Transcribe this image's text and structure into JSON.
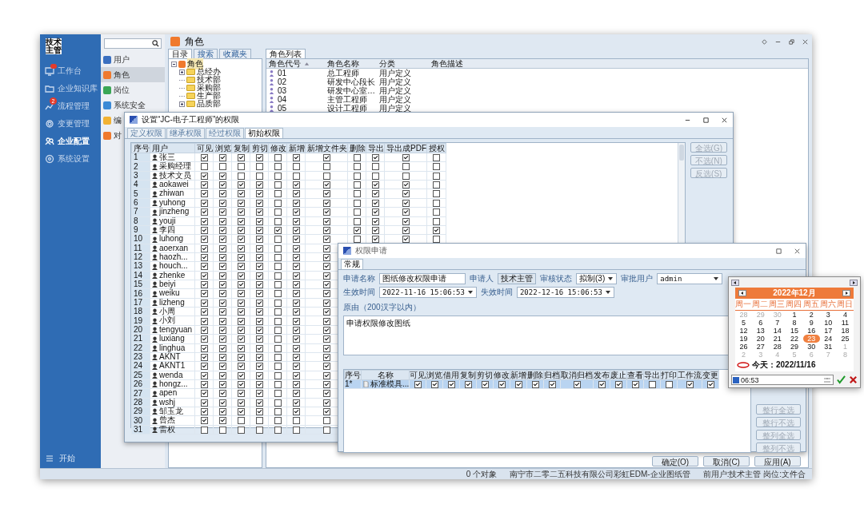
{
  "app": {
    "logo": "技术主管",
    "nav": [
      {
        "label": "工作台",
        "selected": false,
        "alert": true
      },
      {
        "label": "企业知识库",
        "selected": false,
        "alert": false
      },
      {
        "label": "流程管理",
        "selected": false,
        "alert": false,
        "badge": "2"
      },
      {
        "label": "变更管理",
        "selected": false,
        "alert": false
      },
      {
        "label": "企业配置",
        "selected": true,
        "alert": false
      },
      {
        "label": "系统设置",
        "selected": false,
        "alert": false
      }
    ],
    "start": "开始"
  },
  "modules": {
    "items": [
      {
        "label": "用户",
        "selected": false,
        "color": "#3a6fc0"
      },
      {
        "label": "角色",
        "selected": true,
        "color": "#f07a2e"
      },
      {
        "label": "岗位",
        "selected": false,
        "color": "#3aa655"
      },
      {
        "label": "系统安全",
        "selected": false,
        "color": "#3b8ad6"
      },
      {
        "label": "编",
        "selected": false,
        "color": "#f2b233"
      },
      {
        "label": "对",
        "selected": false,
        "color": "#f07a2e"
      }
    ]
  },
  "role_page": {
    "title": "角色",
    "tabs": [
      {
        "label": "目录",
        "selected": true
      },
      {
        "label": "搜索",
        "selected": false
      },
      {
        "label": "收藏夹",
        "selected": false
      }
    ],
    "tree": {
      "label": "角色",
      "selected": true,
      "children": [
        {
          "label": "总经办",
          "expandable": true,
          "selected": false
        },
        {
          "label": "技术部",
          "expandable": false,
          "selected": false
        },
        {
          "label": "采购部",
          "expandable": false,
          "selected": false
        },
        {
          "label": "生产部",
          "expandable": false,
          "selected": false
        },
        {
          "label": "品质部",
          "expandable": true,
          "selected": false
        }
      ]
    },
    "list_tab": "角色列表",
    "columns": [
      {
        "label": "角色代号",
        "sorted": true
      },
      {
        "label": "角色名称",
        "sorted": false
      },
      {
        "label": "分类",
        "sorted": false
      },
      {
        "label": "角色描述",
        "sorted": false
      }
    ],
    "rows": [
      [
        "01",
        "总工程师",
        "用户定义"
      ],
      [
        "02",
        "研发中心段长",
        "用户定义"
      ],
      [
        "03",
        "研发中心室…",
        "用户定义"
      ],
      [
        "04",
        "主管工程师",
        "用户定义"
      ],
      [
        "05",
        "设计工程师",
        "用户定义"
      ]
    ]
  },
  "perm_dialog": {
    "title": "设置“JC-电子工程师”的权限",
    "tabs": [
      {
        "label": "定义权限",
        "selected": false
      },
      {
        "label": "继承权限",
        "selected": false
      },
      {
        "label": "经过权限",
        "selected": false
      },
      {
        "label": "初始权限",
        "selected": true
      }
    ],
    "columns": [
      "序号",
      "用户",
      "可见",
      "浏览",
      "复制",
      "剪切",
      "修改",
      "新增",
      "新增文件夹",
      "删除",
      "导出",
      "导出成PDF",
      "授权"
    ],
    "rows": [
      {
        "no": "1",
        "user": "张三",
        "checks": [
          true,
          true,
          true,
          true,
          false,
          true,
          true,
          false,
          true,
          true,
          false
        ]
      },
      {
        "no": "2",
        "user": "采购经理",
        "checks": [
          false,
          false,
          false,
          false,
          false,
          false,
          false,
          false,
          false,
          false,
          false
        ]
      },
      {
        "no": "3",
        "user": "技术文员",
        "checks": [
          true,
          true,
          false,
          false,
          false,
          false,
          false,
          false,
          false,
          false,
          false
        ]
      },
      {
        "no": "4",
        "user": "aokawei",
        "checks": [
          true,
          true,
          true,
          true,
          false,
          true,
          true,
          false,
          true,
          true,
          false
        ]
      },
      {
        "no": "5",
        "user": "zhiwan",
        "checks": [
          true,
          true,
          true,
          true,
          false,
          true,
          true,
          false,
          true,
          true,
          false
        ]
      },
      {
        "no": "6",
        "user": "yuhong",
        "checks": [
          true,
          true,
          true,
          true,
          false,
          true,
          true,
          false,
          true,
          true,
          false
        ]
      },
      {
        "no": "7",
        "user": "jinzheng",
        "checks": [
          true,
          true,
          true,
          true,
          false,
          true,
          true,
          false,
          true,
          true,
          false
        ]
      },
      {
        "no": "8",
        "user": "youji",
        "checks": [
          true,
          true,
          true,
          true,
          false,
          true,
          true,
          false,
          true,
          true,
          false
        ]
      },
      {
        "no": "9",
        "user": "李四",
        "checks": [
          true,
          true,
          true,
          true,
          true,
          true,
          true,
          true,
          true,
          true,
          true
        ]
      },
      {
        "no": "10",
        "user": "luhong",
        "checks": [
          true,
          true,
          true,
          true,
          false,
          true,
          true,
          false,
          true,
          true,
          false
        ]
      },
      {
        "no": "11",
        "user": "aoerxan",
        "checks": [
          true,
          true,
          true,
          true,
          false,
          true,
          true
        ]
      },
      {
        "no": "12",
        "user": "haozh...",
        "checks": [
          true,
          true,
          true,
          true,
          false,
          true,
          true
        ]
      },
      {
        "no": "13",
        "user": "houch...",
        "checks": [
          true,
          true,
          true,
          true,
          false,
          true,
          true
        ]
      },
      {
        "no": "14",
        "user": "zhenke",
        "checks": [
          true,
          true,
          true,
          true,
          false,
          true,
          true
        ]
      },
      {
        "no": "15",
        "user": "beiyi",
        "checks": [
          true,
          true,
          true,
          true,
          false,
          true,
          true
        ]
      },
      {
        "no": "16",
        "user": "weiku",
        "checks": [
          true,
          true,
          true,
          true,
          false,
          true,
          true
        ]
      },
      {
        "no": "17",
        "user": "lizheng",
        "checks": [
          true,
          true,
          true,
          true,
          false,
          true,
          true
        ]
      },
      {
        "no": "18",
        "user": "小周",
        "checks": [
          true,
          true,
          true,
          true,
          false,
          true,
          true
        ]
      },
      {
        "no": "19",
        "user": "小刘",
        "checks": [
          true,
          true,
          true,
          true,
          false,
          true,
          true
        ]
      },
      {
        "no": "20",
        "user": "tengyuan",
        "checks": [
          true,
          true,
          true,
          true,
          false,
          true,
          true
        ]
      },
      {
        "no": "21",
        "user": "luxiang",
        "checks": [
          true,
          true,
          true,
          true,
          false,
          true,
          true
        ]
      },
      {
        "no": "22",
        "user": "linghua",
        "checks": [
          true,
          true,
          true,
          true,
          false,
          true,
          true
        ]
      },
      {
        "no": "23",
        "user": "AKNT",
        "checks": [
          true,
          true,
          true,
          true,
          false,
          true,
          true
        ]
      },
      {
        "no": "24",
        "user": "AKNT1",
        "checks": [
          true,
          true,
          true,
          true,
          false,
          true,
          true
        ]
      },
      {
        "no": "25",
        "user": "wenda",
        "checks": [
          true,
          true,
          true,
          true,
          false,
          true,
          true
        ]
      },
      {
        "no": "26",
        "user": "hongz...",
        "checks": [
          true,
          true,
          true,
          true,
          false,
          true,
          true
        ]
      },
      {
        "no": "27",
        "user": "apen",
        "checks": [
          true,
          true,
          true,
          true,
          false,
          true,
          true
        ]
      },
      {
        "no": "28",
        "user": "wshj",
        "checks": [
          true,
          true,
          true,
          true,
          false,
          true,
          true
        ]
      },
      {
        "no": "29",
        "user": "邹玉龙",
        "checks": [
          true,
          true,
          true,
          true,
          false,
          true,
          true
        ]
      },
      {
        "no": "30",
        "user": "曾杰",
        "checks": [
          true,
          true,
          false,
          false,
          false,
          false,
          false
        ]
      },
      {
        "no": "31",
        "user": "雷权",
        "checks": [
          false,
          false,
          false,
          false,
          false,
          false,
          false
        ]
      }
    ],
    "buttons": [
      {
        "label": "全选(G)",
        "disabled": true
      },
      {
        "label": "不选(N)",
        "disabled": true
      },
      {
        "label": "反选(S)",
        "disabled": true
      }
    ]
  },
  "request_dialog": {
    "title": "权限申请",
    "tab": "常规",
    "name_label": "申请名称",
    "name": "图纸修改权限申请",
    "applicant_label": "申请人",
    "applicant": "技术主管",
    "status_label": "审核状态",
    "status": "拟制(3)",
    "approver_label": "审批用户",
    "approver": "admin",
    "start_label": "生效时间",
    "start": "2022-11-16 15:06:53",
    "end_label": "失效时间",
    "end": "2022-12-16 15:06:53",
    "reason_label": "原由（200汉字以内）",
    "reason": "申请权限修改图纸",
    "columns": [
      "序号",
      "名称",
      "可见",
      "浏览",
      "借用",
      "复制",
      "剪切",
      "修改",
      "新增",
      "删除",
      "归档",
      "取消归档",
      "发布",
      "废止",
      "查看",
      "导出",
      "打印",
      "工作流",
      "变更"
    ],
    "rows": [
      {
        "no": "1*",
        "name": "标准模具...",
        "selected": true,
        "checks": [
          true,
          true,
          true,
          true,
          true,
          true,
          true,
          true,
          true,
          true,
          true,
          true,
          true,
          false,
          false,
          true,
          true
        ]
      }
    ],
    "side_buttons": [
      {
        "label": "整行全选",
        "disabled": true
      },
      {
        "label": "整行不选",
        "disabled": true
      },
      {
        "label": "整列全选",
        "disabled": true
      },
      {
        "label": "整列不选",
        "disabled": true
      }
    ],
    "buttons": [
      "确定(O)",
      "取消(C)",
      "应用(A)"
    ]
  },
  "calendar": {
    "month": "2022年12月",
    "weekdays": [
      "周一",
      "周二",
      "周三",
      "周四",
      "周五",
      "周六",
      "周日"
    ],
    "days": [
      {
        "label": "28",
        "muted": true,
        "selected": false
      },
      {
        "label": "29",
        "muted": true,
        "selected": false
      },
      {
        "label": "30",
        "muted": true,
        "selected": false
      },
      {
        "label": "1",
        "muted": false,
        "selected": false
      },
      {
        "label": "2",
        "muted": false,
        "selected": false
      },
      {
        "label": "3",
        "muted": false,
        "selected": false
      },
      {
        "label": "4",
        "muted": false,
        "selected": false
      },
      {
        "label": "5",
        "muted": false,
        "selected": false
      },
      {
        "label": "6",
        "muted": false,
        "selected": false
      },
      {
        "label": "7",
        "muted": false,
        "selected": false
      },
      {
        "label": "8",
        "muted": false,
        "selected": false
      },
      {
        "label": "9",
        "muted": false,
        "selected": false
      },
      {
        "label": "10",
        "muted": false,
        "selected": false
      },
      {
        "label": "11",
        "muted": false,
        "selected": false
      },
      {
        "label": "12",
        "muted": false,
        "selected": false
      },
      {
        "label": "13",
        "muted": false,
        "selected": false
      },
      {
        "label": "14",
        "muted": false,
        "selected": false
      },
      {
        "label": "15",
        "muted": false,
        "selected": false
      },
      {
        "label": "16",
        "muted": false,
        "selected": false
      },
      {
        "label": "17",
        "muted": false,
        "selected": false
      },
      {
        "label": "18",
        "muted": false,
        "selected": false
      },
      {
        "label": "19",
        "muted": false,
        "selected": false
      },
      {
        "label": "20",
        "muted": false,
        "selected": false
      },
      {
        "label": "21",
        "muted": false,
        "selected": false
      },
      {
        "label": "22",
        "muted": false,
        "selected": false
      },
      {
        "label": "23",
        "muted": false,
        "selected": true
      },
      {
        "label": "24",
        "muted": false,
        "selected": false
      },
      {
        "label": "25",
        "muted": false,
        "selected": false
      },
      {
        "label": "26",
        "muted": false,
        "selected": false
      },
      {
        "label": "27",
        "muted": false,
        "selected": false
      },
      {
        "label": "28",
        "muted": false,
        "selected": false
      },
      {
        "label": "29",
        "muted": false,
        "selected": false
      },
      {
        "label": "30",
        "muted": false,
        "selected": false
      },
      {
        "label": "31",
        "muted": false,
        "selected": false
      },
      {
        "label": "1",
        "muted": true,
        "selected": false
      },
      {
        "label": "2",
        "muted": true,
        "selected": false
      },
      {
        "label": "3",
        "muted": true,
        "selected": false
      },
      {
        "label": "4",
        "muted": true,
        "selected": false
      },
      {
        "label": "5",
        "muted": true,
        "selected": false
      },
      {
        "label": "6",
        "muted": true,
        "selected": false
      },
      {
        "label": "7",
        "muted": true,
        "selected": false
      },
      {
        "label": "8",
        "muted": true,
        "selected": false
      }
    ],
    "today": "今天：2022/11/16",
    "time": "06:53"
  },
  "status_bar": [
    "0 个对象",
    "南宁市二零二五科技有限公司彩虹EDM-企业图纸管",
    "前用户:技术主管 岗位:文件合"
  ]
}
